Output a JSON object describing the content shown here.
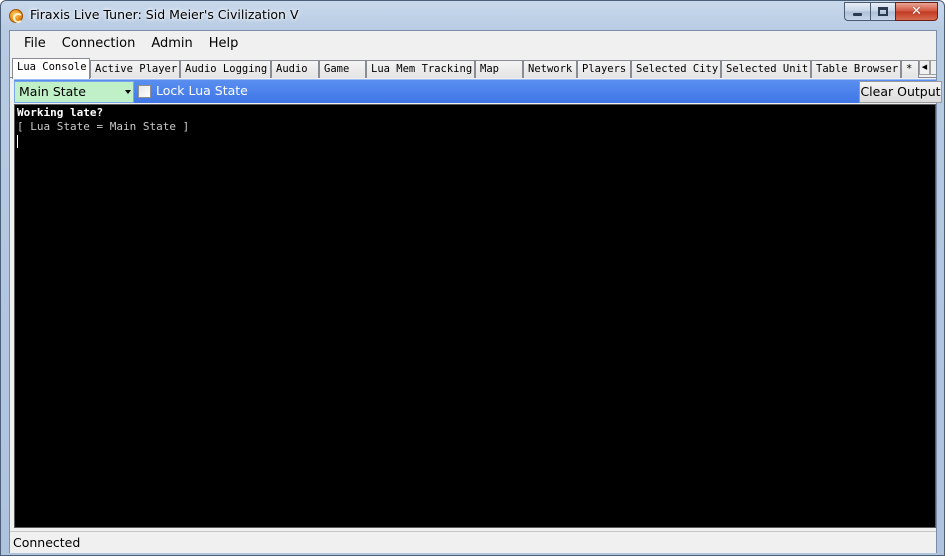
{
  "window": {
    "title": "Firaxis Live Tuner: Sid Meier's Civilization V",
    "controls": {
      "minimize": "minimize",
      "maximize": "maximize",
      "close": "✕"
    }
  },
  "menu": [
    "File",
    "Connection",
    "Admin",
    "Help"
  ],
  "tabs": [
    "Lua Console",
    "Active Player",
    "Audio Logging",
    "Audio",
    "Game",
    "Lua Mem Tracking",
    "Map",
    "Network",
    "Players",
    "Selected City",
    "Selected Unit",
    "Table Browser",
    "* :"
  ],
  "active_tab_index": 0,
  "tab_scroll": {
    "left": "◀",
    "right": "▶"
  },
  "toolbar": {
    "state_select_value": "Main State",
    "lock_label": "Lock Lua State",
    "lock_checked": false,
    "clear_button": "Clear Output"
  },
  "console": {
    "lines": [
      {
        "text": "Working late?",
        "style": "bold"
      },
      {
        "text": "[ Lua State = Main State ]",
        "style": "dim"
      }
    ]
  },
  "status": {
    "text": "Connected"
  },
  "colors": {
    "toolbar_blue": "#3f76e6",
    "state_select_bg": "#bff0c7",
    "console_bg": "#000000",
    "close_red": "#c23a22"
  }
}
